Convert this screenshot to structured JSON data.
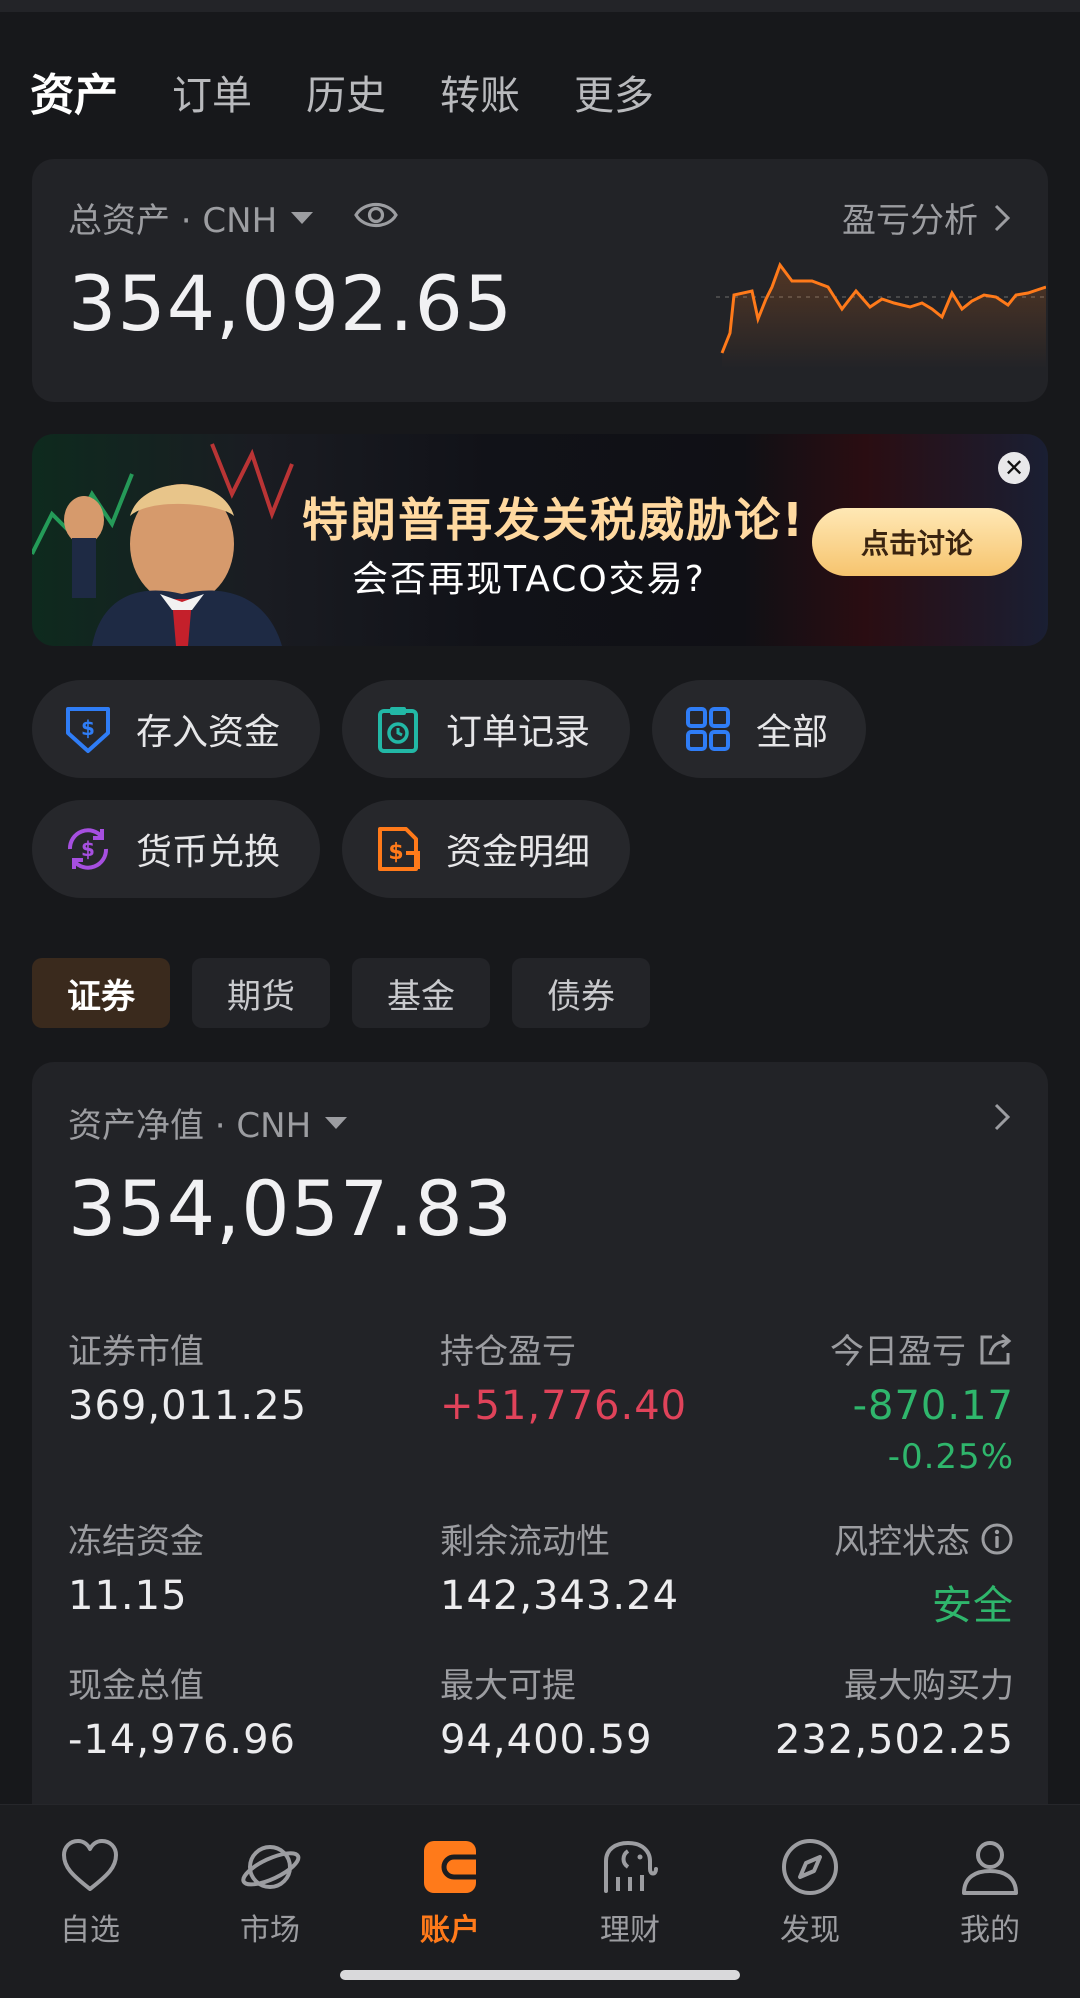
{
  "top_tabs": [
    "资产",
    "订单",
    "历史",
    "转账",
    "更多"
  ],
  "total_assets": {
    "label": "总资产 · CNH",
    "value": "354,092.65",
    "pl_analysis": "盈亏分析",
    "sparkline_color": "#ff7a1a"
  },
  "banner": {
    "title": "特朗普再发关税威胁论!",
    "subtitle": "会否再现TACO交易?",
    "button": "点击讨论",
    "close": "✕"
  },
  "quick_actions": [
    {
      "label": "存入资金",
      "icon": "deposit-icon",
      "color": "#2f7df6"
    },
    {
      "label": "订单记录",
      "icon": "order-record-icon",
      "color": "#22b8a6"
    },
    {
      "label": "全部",
      "icon": "grid-icon",
      "color": "#2f7df6"
    },
    {
      "label": "货币兑换",
      "icon": "currency-exchange-icon",
      "color": "#a64fe0"
    },
    {
      "label": "资金明细",
      "icon": "fund-detail-icon",
      "color": "#ff7a1a"
    }
  ],
  "segments": [
    "证券",
    "期货",
    "基金",
    "债券"
  ],
  "net_assets": {
    "label": "资产净值 · CNH",
    "value": "354,057.83",
    "stats": {
      "securities_value_label": "证券市值",
      "securities_value": "369,011.25",
      "position_pl_label": "持仓盈亏",
      "position_pl": "+51,776.40",
      "today_pl_label": "今日盈亏",
      "today_pl": "-870.17",
      "today_pl_pct": "-0.25%",
      "frozen_label": "冻结资金",
      "frozen": "11.15",
      "liquidity_label": "剩余流动性",
      "liquidity": "142,343.24",
      "risk_label": "风控状态",
      "risk": "安全",
      "cash_label": "现金总值",
      "cash": "-14,976.96",
      "max_withdraw_label": "最大可提",
      "max_withdraw": "94,400.59",
      "max_buy_label": "最大购买力",
      "max_buy": "232,502.25"
    }
  },
  "bottom_nav": [
    {
      "label": "自选",
      "icon": "heart-icon"
    },
    {
      "label": "市场",
      "icon": "planet-icon"
    },
    {
      "label": "账户",
      "icon": "wallet-icon",
      "active": true
    },
    {
      "label": "理财",
      "icon": "elephant-icon"
    },
    {
      "label": "发现",
      "icon": "compass-icon"
    },
    {
      "label": "我的",
      "icon": "user-icon"
    }
  ],
  "colors": {
    "accent": "#ff7a1a",
    "up": "#e0435a",
    "down": "#2fb66c"
  }
}
